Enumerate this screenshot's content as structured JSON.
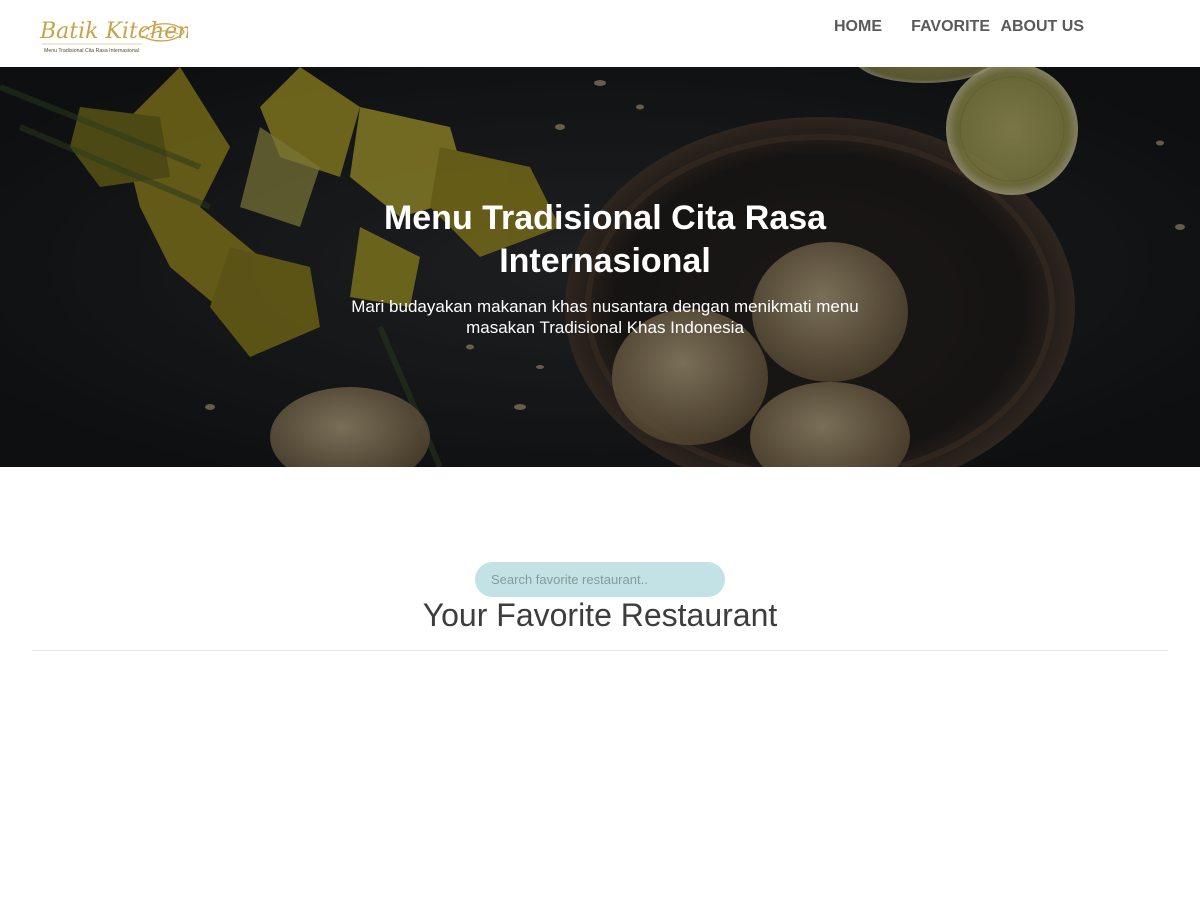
{
  "logo": {
    "name": "Batik Kitchen",
    "tagline": "Menu Tradisional Cita Rasa Internasional"
  },
  "nav": {
    "items": [
      {
        "label": "HOME"
      },
      {
        "label": "FAVORITE"
      },
      {
        "label": "ABOUT US"
      }
    ]
  },
  "hero": {
    "title": "Menu Tradisional Cita Rasa Internasional",
    "subtitle": "Mari budayakan makanan khas nusantara dengan menikmati menu masakan Tradisional Khas Indonesia"
  },
  "search": {
    "placeholder": "Search favorite restaurant.."
  },
  "section": {
    "title": "Your Favorite Restaurant"
  },
  "colors": {
    "accent_gold": "#c9a24a",
    "search_bg": "#c2e2e5",
    "nav_text": "#5a5a5a"
  }
}
